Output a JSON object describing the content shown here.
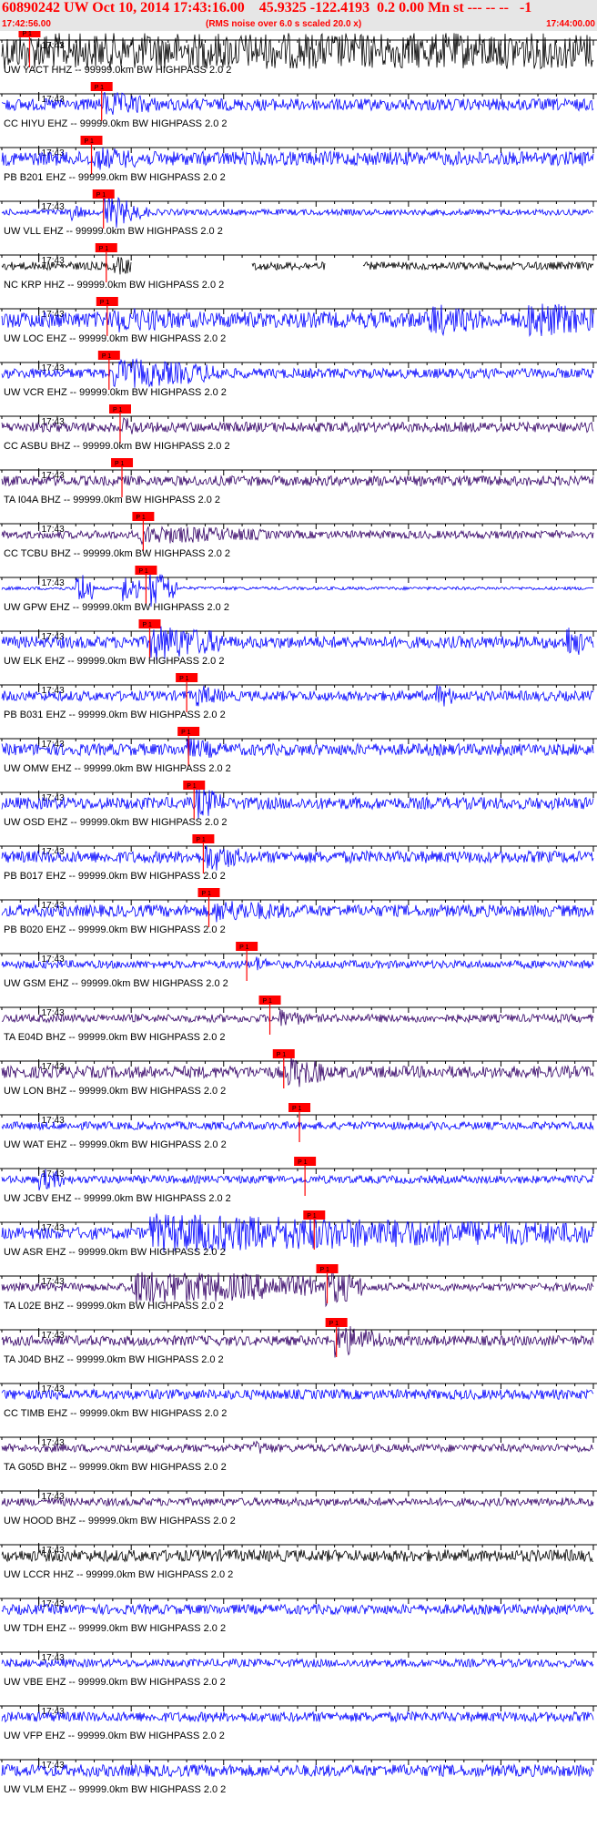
{
  "header": {
    "title": "60890242 UW Oct 10, 2014 17:43:16.00    45.9325 -122.4193  0.2 0.00 Mn st --- -- --   -1",
    "start_time": "17:42:56.00",
    "end_time": "17:44:00.00",
    "rms_note": "(RMS noise over 6.0 s scaled 20.0 x)"
  },
  "colors": {
    "blue": "#0000ff",
    "purple": "#330066",
    "black": "#000000",
    "pick": "#ff0000",
    "header_bg": "#e6e6e6"
  },
  "chart_data": {
    "type": "line",
    "x_start": "17:42:56.00",
    "x_end": "17:44:00.00",
    "duration_s": 64,
    "minute_label": "17:43",
    "pick_label": "P 1",
    "traces": [
      {
        "label": "UW YACT HHZ -- 99999.0km BW  HIGHPASS  2.0  2",
        "color": "black",
        "amp": 0.9,
        "pick_s": 3.0,
        "events": [
          [
            2,
            64,
            0.8
          ]
        ]
      },
      {
        "label": "CC HIYU EHZ -- 99999.0km BW  HIGHPASS  2.0  2",
        "color": "blue",
        "amp": 0.3,
        "pick_s": 10.8,
        "events": [
          [
            11,
            6,
            0.7
          ]
        ]
      },
      {
        "label": "PB B201 EHZ -- 99999.0km BW  HIGHPASS  2.0  2",
        "color": "blue",
        "amp": 0.35,
        "pick_s": 9.7,
        "events": [
          [
            10,
            8,
            0.6
          ]
        ]
      },
      {
        "label": "UW VLL EHZ -- 99999.0km BW  HIGHPASS  2.0  2",
        "color": "blue",
        "amp": 0.15,
        "pick_s": 11.0,
        "events": [
          [
            7,
            2,
            0.5
          ],
          [
            11,
            3,
            1.0
          ],
          [
            13,
            3,
            0.5
          ]
        ]
      },
      {
        "label": "NC KRP HHZ -- 99999.0km BW  HIGHPASS  2.0  2",
        "color": "black",
        "amp": 0.2,
        "pick_s": 11.3,
        "gaps": [
          [
            14,
            27
          ],
          [
            35,
            39
          ]
        ],
        "events": [
          [
            12,
            4,
            0.5
          ]
        ]
      },
      {
        "label": "UW LOC EHZ -- 99999.0km BW  HIGHPASS  2.0  2",
        "color": "blue",
        "amp": 0.4,
        "pick_s": 11.4,
        "events": [
          [
            12,
            10,
            0.7
          ],
          [
            46,
            6,
            0.9
          ],
          [
            57,
            8,
            1.0
          ]
        ]
      },
      {
        "label": "UW VCR EHZ -- 99999.0km BW  HIGHPASS  2.0  2",
        "color": "blue",
        "amp": 0.25,
        "pick_s": 11.6,
        "events": [
          [
            12,
            12,
            0.8
          ]
        ]
      },
      {
        "label": "CC ASBU BHZ -- 99999.0km BW  HIGHPASS  2.0  2",
        "color": "purple",
        "amp": 0.25,
        "pick_s": 12.8,
        "events": [
          [
            13,
            3,
            0.5
          ]
        ]
      },
      {
        "label": "TA I04A BHZ -- 99999.0km BW  HIGHPASS  2.0  2",
        "color": "purple",
        "amp": 0.25,
        "pick_s": 13.0,
        "events": [
          [
            13,
            2,
            0.3
          ]
        ]
      },
      {
        "label": "CC TCBU BHZ -- 99999.0km BW  HIGHPASS  2.0  2",
        "color": "purple",
        "amp": 0.2,
        "pick_s": 15.3,
        "events": [
          [
            15,
            14,
            0.5
          ]
        ]
      },
      {
        "label": "UW GPW EHZ -- 99999.0km BW  HIGHPASS  2.0  2",
        "color": "blue",
        "amp": 0.08,
        "pick_s": 15.6,
        "events": [
          [
            8,
            2,
            1.0
          ],
          [
            13,
            2,
            0.8
          ],
          [
            16,
            3,
            1.0
          ]
        ]
      },
      {
        "label": "UW ELK EHZ -- 99999.0km BW  HIGHPASS  2.0  2",
        "color": "blue",
        "amp": 0.3,
        "pick_s": 16.0,
        "events": [
          [
            16,
            8,
            1.0
          ],
          [
            61,
            2,
            1.0
          ]
        ]
      },
      {
        "label": "PB B031 EHZ -- 99999.0km BW  HIGHPASS  2.0  2",
        "color": "blue",
        "amp": 0.25,
        "pick_s": 20.0,
        "events": [
          [
            21,
            3,
            0.6
          ],
          [
            47,
            2,
            0.7
          ]
        ]
      },
      {
        "label": "UW OMW EHZ -- 99999.0km BW  HIGHPASS  2.0  2",
        "color": "blue",
        "amp": 0.3,
        "pick_s": 20.2,
        "events": [
          [
            20,
            4,
            0.6
          ]
        ]
      },
      {
        "label": "UW OSD EHZ -- 99999.0km BW  HIGHPASS  2.0  2",
        "color": "blue",
        "amp": 0.3,
        "pick_s": 20.8,
        "events": [
          [
            21,
            3,
            0.9
          ]
        ]
      },
      {
        "label": "PB B017 EHZ -- 99999.0km BW  HIGHPASS  2.0  2",
        "color": "blue",
        "amp": 0.3,
        "pick_s": 21.8,
        "events": [
          [
            22,
            4,
            0.8
          ]
        ]
      },
      {
        "label": "PB B020 EHZ -- 99999.0km BW  HIGHPASS  2.0  2",
        "color": "blue",
        "amp": 0.3,
        "pick_s": 22.4,
        "events": [
          [
            23,
            10,
            0.6
          ]
        ]
      },
      {
        "label": "UW GSM EHZ -- 99999.0km BW  HIGHPASS  2.0  2",
        "color": "blue",
        "amp": 0.2,
        "pick_s": 26.5,
        "events": [
          [
            27,
            2,
            0.5
          ]
        ]
      },
      {
        "label": "TA E04D BHZ -- 99999.0km BW  HIGHPASS  2.0  2",
        "color": "purple",
        "amp": 0.2,
        "pick_s": 29.0,
        "events": [
          [
            30,
            3,
            0.5
          ]
        ]
      },
      {
        "label": "UW LON BHZ -- 99999.0km BW  HIGHPASS  2.0  2",
        "color": "purple",
        "amp": 0.3,
        "pick_s": 30.5,
        "events": [
          [
            31,
            4,
            0.9
          ]
        ]
      },
      {
        "label": "UW WAT EHZ -- 99999.0km BW  HIGHPASS  2.0  2",
        "color": "blue",
        "amp": 0.2,
        "pick_s": 32.2,
        "events": []
      },
      {
        "label": "UW JCBV EHZ -- 99999.0km BW  HIGHPASS  2.0  2",
        "color": "blue",
        "amp": 0.2,
        "pick_s": 32.8,
        "events": [
          [
            4,
            3,
            0.6
          ]
        ]
      },
      {
        "label": "UW ASR EHZ -- 99999.0km BW  HIGHPASS  2.0  2",
        "color": "blue",
        "amp": 0.3,
        "pick_s": 33.8,
        "events": [
          [
            16,
            48,
            1.0
          ]
        ]
      },
      {
        "label": "TA L02E BHZ -- 99999.0km BW  HIGHPASS  2.0  2",
        "color": "purple",
        "amp": 0.2,
        "pick_s": 35.2,
        "events": [
          [
            14,
            24,
            0.9
          ],
          [
            35,
            4,
            1.0
          ]
        ]
      },
      {
        "label": "TA J04D BHZ -- 99999.0km BW  HIGHPASS  2.0  2",
        "color": "purple",
        "amp": 0.25,
        "pick_s": 36.2,
        "events": [
          [
            36,
            5,
            0.9
          ]
        ]
      },
      {
        "label": "CC TIMB EHZ -- 99999.0km BW  HIGHPASS  2.0  2",
        "color": "blue",
        "amp": 0.25,
        "pick_s": null,
        "events": []
      },
      {
        "label": "TA G05D BHZ -- 99999.0km BW  HIGHPASS  2.0  2",
        "color": "purple",
        "amp": 0.2,
        "pick_s": null,
        "events": [
          [
            27,
            3,
            0.4
          ]
        ]
      },
      {
        "label": "UW HOOD BHZ -- 99999.0km BW  HIGHPASS  2.0  2",
        "color": "purple",
        "amp": 0.2,
        "pick_s": null,
        "events": []
      },
      {
        "label": "UW LCCR HHZ -- 99999.0km BW  HIGHPASS  2.0  2",
        "color": "black",
        "amp": 0.3,
        "pick_s": null,
        "events": []
      },
      {
        "label": "UW TDH EHZ -- 99999.0km BW  HIGHPASS  2.0  2",
        "color": "blue",
        "amp": 0.25,
        "pick_s": null,
        "events": []
      },
      {
        "label": "UW VBE EHZ -- 99999.0km BW  HIGHPASS  2.0  2",
        "color": "blue",
        "amp": 0.2,
        "pick_s": null,
        "events": []
      },
      {
        "label": "UW VFP EHZ -- 99999.0km BW  HIGHPASS  2.0  2",
        "color": "blue",
        "amp": 0.25,
        "pick_s": null,
        "events": []
      },
      {
        "label": "UW VLM EHZ -- 99999.0km BW  HIGHPASS  2.0  2",
        "color": "blue",
        "amp": 0.3,
        "pick_s": null,
        "events": []
      }
    ]
  }
}
